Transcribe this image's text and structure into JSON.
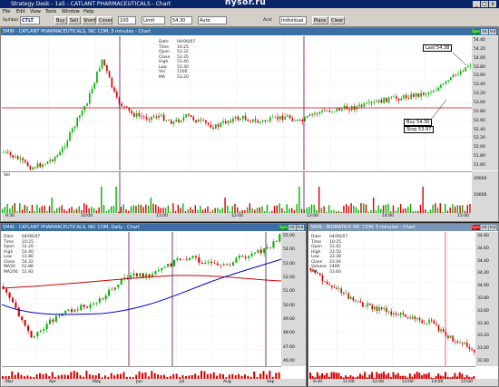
{
  "window": {
    "title": "Strategy Desk - 1a5 - CATLANT PHARMACEUTICALS - Chart",
    "brand": "nysor.ru",
    "controls": [
      "_",
      "□",
      "x"
    ]
  },
  "menu": [
    "File",
    "Edit",
    "View",
    "Tools",
    "Window",
    "Help"
  ],
  "toolbar": {
    "symbol_label": "Symbol",
    "symbol_value": "CTLT",
    "buttons": [
      "Buy",
      "Sell",
      "Short",
      "Cover"
    ],
    "quantity_value": "100",
    "order_type_value": "Limit",
    "price_value": "54.30",
    "account_label": "Acct",
    "account_value": "Individual",
    "route_value": "Auto",
    "extra_buttons": [
      "Place",
      "Clear"
    ]
  },
  "main_chart": {
    "title": "5MIN - CATLANT PHARMACEUTICALS, INC COM, 5 minutes - Chart",
    "tabs": [
      "Sym",
      "Int",
      "Ind"
    ],
    "data_window": {
      "rows": [
        {
          "k": "Date",
          "v": "04/06/07"
        },
        {
          "k": "Time",
          "v": "10:25"
        },
        {
          "k": "Open",
          "v": "53.32"
        },
        {
          "k": "Close",
          "v": "53.35"
        },
        {
          "k": "High",
          "v": "53.40"
        },
        {
          "k": "Low",
          "v": "53.30"
        },
        {
          "k": "Vol",
          "v": "1200"
        },
        {
          "k": "MA",
          "v": "53.20"
        }
      ]
    },
    "callouts": [
      {
        "text": "Last 54.38"
      },
      {
        "text": "Buy 54.30"
      },
      {
        "text": "Stop 53.97"
      }
    ],
    "price_axis": [
      "54.40",
      "54.20",
      "54.00",
      "53.80",
      "53.60",
      "53.40",
      "53.20",
      "53.00",
      "52.80",
      "52.60",
      "52.40",
      "52.20",
      "52.00",
      "51.80",
      "51.60"
    ],
    "volume_label": "Vol",
    "volume_axis": [
      "20000",
      "10000"
    ],
    "time_axis": [
      "9:30",
      "10:00",
      "11:00",
      "12:00",
      "13:00",
      "14:00",
      "15:00"
    ]
  },
  "left_chart": {
    "title": "5MIN - CATLANT PHARMACEUTICALS, INC COM, Daily - Chart",
    "tabs": [
      "Sym",
      "Int",
      "Ind"
    ],
    "data_window": {
      "rows": [
        {
          "k": "Date",
          "v": "04/06/07"
        },
        {
          "k": "Time",
          "v": "10:25"
        },
        {
          "k": "Open",
          "v": "52.20"
        },
        {
          "k": "High",
          "v": "54.40"
        },
        {
          "k": "Low",
          "v": "51.80"
        },
        {
          "k": "Close",
          "v": "54.32"
        },
        {
          "k": "MA50",
          "v": "52.86"
        },
        {
          "k": "MA200",
          "v": "51.92"
        }
      ]
    },
    "price_axis": [
      "55.00",
      "54.00",
      "53.00",
      "52.00",
      "51.00",
      "50.00",
      "49.00",
      "48.00",
      "47.00",
      "46.00"
    ],
    "time_axis": [
      "Mar",
      "Apr",
      "May",
      "Jun",
      "Jul",
      "Aug",
      "Sep"
    ]
  },
  "right_chart": {
    "title": "5MIN - BIOMATRIX INC COM, 5 minutes - Chart",
    "tabs": [
      "Sym",
      "Int",
      "Ind"
    ],
    "data_window": {
      "rows": [
        {
          "k": "Date",
          "v": "04/06/07"
        },
        {
          "k": "Time",
          "v": "10:25"
        },
        {
          "k": "Open",
          "v": "33.42"
        },
        {
          "k": "High",
          "v": "33.50"
        },
        {
          "k": "Low",
          "v": "33.38"
        },
        {
          "k": "Close",
          "v": "33.44"
        },
        {
          "k": "Volume",
          "v": "2400"
        },
        {
          "k": "MA",
          "v": "33.60"
        }
      ]
    },
    "price_axis": [
      "34.80",
      "34.60",
      "34.40",
      "34.20",
      "34.00",
      "33.80",
      "33.60",
      "33.40",
      "33.20",
      "33.00",
      "32.80"
    ],
    "time_axis": [
      "9:30",
      "11:00",
      "12:00",
      "13:00",
      "14:00",
      "15:00"
    ]
  },
  "colors": {
    "up_candle": "#00b000",
    "down_candle": "#d00000",
    "support_line": "#d00000",
    "marker_line": "#5a0a5a",
    "ma_blue": "#0000d0",
    "title_active": "#3a6ea5"
  }
}
